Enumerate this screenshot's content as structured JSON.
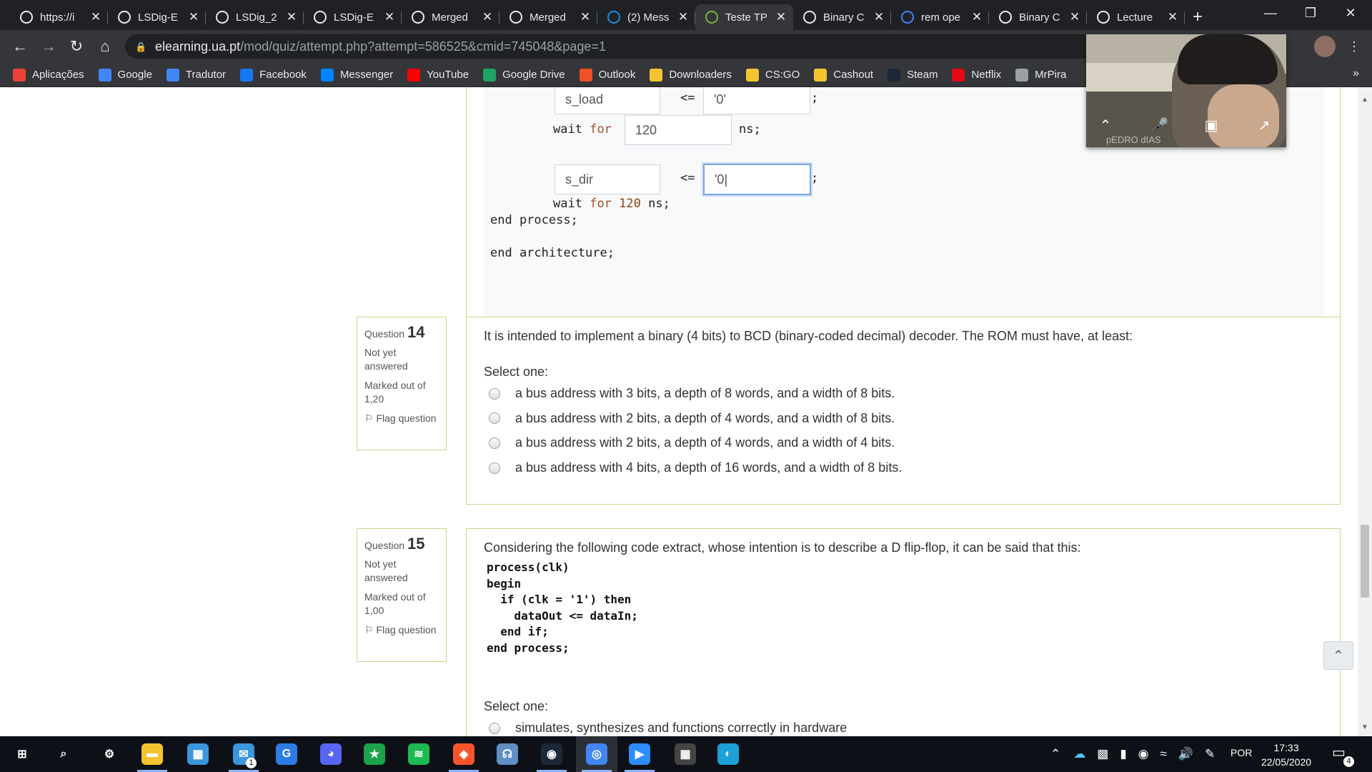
{
  "browser": {
    "tabs": [
      {
        "title": "https://i",
        "icon": "globe-icon",
        "color": "#e8eaed"
      },
      {
        "title": "LSDig-E",
        "icon": "globe-icon",
        "color": "#e8eaed"
      },
      {
        "title": "LSDig_2",
        "icon": "globe-icon",
        "color": "#e8eaed"
      },
      {
        "title": "LSDig-E",
        "icon": "globe-icon",
        "color": "#e8eaed"
      },
      {
        "title": "Merged",
        "icon": "globe-icon",
        "color": "#e8eaed"
      },
      {
        "title": "Merged",
        "icon": "globe-icon",
        "color": "#e8eaed"
      },
      {
        "title": "(2) Mess",
        "icon": "messenger-icon",
        "color": "#1e88e5"
      },
      {
        "title": "Teste TP",
        "icon": "moodle-icon",
        "color": "#7cb342"
      },
      {
        "title": "Binary C",
        "icon": "sheet-icon",
        "color": "#e8eaed"
      },
      {
        "title": "rem ope",
        "icon": "google-icon",
        "color": "#4285f4"
      },
      {
        "title": "Binary C",
        "icon": "sheet-icon",
        "color": "#e8eaed"
      },
      {
        "title": "Lecture",
        "icon": "globe-icon",
        "color": "#e8eaed"
      }
    ],
    "close_glyph": "✕",
    "newtab_glyph": "+",
    "url_host": "elearning.ua.pt",
    "url_path": "/mod/quiz/attempt.php?attempt=586525&cmid=745048&page=1",
    "bookmarks": [
      {
        "label": "Aplicações",
        "icon": "apps-grid-icon",
        "color": "#ea4335"
      },
      {
        "label": "Google",
        "icon": "google-icon",
        "color": "#4285f4"
      },
      {
        "label": "Tradutor",
        "icon": "translate-icon",
        "color": "#4285f4"
      },
      {
        "label": "Facebook",
        "icon": "facebook-icon",
        "color": "#1877f2"
      },
      {
        "label": "Messenger",
        "icon": "messenger-icon",
        "color": "#0084ff"
      },
      {
        "label": "YouTube",
        "icon": "youtube-icon",
        "color": "#ff0000"
      },
      {
        "label": "Google Drive",
        "icon": "drive-icon",
        "color": "#1fa463"
      },
      {
        "label": "Outlook",
        "icon": "windows-icon",
        "color": "#f25022"
      },
      {
        "label": "Downloaders",
        "icon": "folder-icon",
        "color": "#f4c430"
      },
      {
        "label": "CS:GO",
        "icon": "folder-icon",
        "color": "#f4c430"
      },
      {
        "label": "Cashout",
        "icon": "folder-icon",
        "color": "#f4c430"
      },
      {
        "label": "Steam",
        "icon": "steam-icon",
        "color": "#1b2838"
      },
      {
        "label": "Netflix",
        "icon": "netflix-icon",
        "color": "#e50914"
      },
      {
        "label": "MrPira",
        "icon": "pirate-icon",
        "color": "#9aa0a6"
      }
    ],
    "more_glyph": "»"
  },
  "quiz_prev": {
    "line1_field_name": "s_load",
    "line1_op": "<=",
    "line1_field_value": "'0'",
    "semicolon": ";",
    "wait_kw": "wait",
    "for_kw": "for",
    "wait_value": "120",
    "ns_semicolon": "ns;",
    "line2_field_name": "s_dir",
    "line2_op": "<=",
    "line2_field_value": "'0|",
    "wait2_num": "120",
    "end_process": "end process;",
    "end_architecture": "end architecture;"
  },
  "q14": {
    "label": "Question",
    "number": "14",
    "state": "Not yet answered",
    "marked": "Marked out of 1,20",
    "flag_glyph": "⚐",
    "flag": "Flag question",
    "text": "It is intended to implement a binary (4 bits) to BCD (binary-coded decimal) decoder. The ROM must have, at least:",
    "select_one": "Select one:",
    "options": [
      "a bus address with 3 bits, a depth of 8 words, and a width of 8 bits.",
      "a bus address with 2 bits, a depth of 4 words, and a width of 8 bits.",
      "a bus address with 2 bits, a depth of 4 words, and a width of 4 bits.",
      "a bus address with 4 bits, a depth of 16 words, and a width of 8 bits."
    ]
  },
  "q15": {
    "label": "Question",
    "number": "15",
    "state": "Not yet answered",
    "marked": "Marked out of 1,00",
    "flag_glyph": "⚐",
    "flag": "Flag question",
    "text": "Considering the following code extract, whose intention is to describe a D flip-flop, it can be said that this:",
    "code": [
      "process(clk)",
      "begin",
      "  if (clk = '1') then",
      "    dataOut <= dataIn;",
      "  end if;",
      "end process;"
    ],
    "select_one": "Select one:",
    "options": [
      "simulates, synthesizes and functions correctly in hardware"
    ]
  },
  "video_call": {
    "participant_name": "pEDRO dIAS"
  },
  "taskbar": {
    "apps": [
      {
        "name": "start",
        "glyph": "⊞",
        "color": "#ffffff"
      },
      {
        "name": "search",
        "glyph": "⌕",
        "color": "#ffffff"
      },
      {
        "name": "settings",
        "glyph": "⚙",
        "color": "#ffffff"
      },
      {
        "name": "file-explorer",
        "glyph": "▬",
        "color": "#f4c430"
      },
      {
        "name": "media",
        "glyph": "▦",
        "color": "#3a96dd"
      },
      {
        "name": "mail",
        "glyph": "✉",
        "color": "#3a96dd"
      },
      {
        "name": "app-g",
        "glyph": "G",
        "color": "#2d7be5"
      },
      {
        "name": "discord",
        "glyph": "◕",
        "color": "#5865f2"
      },
      {
        "name": "game",
        "glyph": "★",
        "color": "#1aa34a"
      },
      {
        "name": "spotify",
        "glyph": "≋",
        "color": "#1db954"
      },
      {
        "name": "brave",
        "glyph": "◆",
        "color": "#fb542b"
      },
      {
        "name": "headset",
        "glyph": "☊",
        "color": "#5f8fc4"
      },
      {
        "name": "steam",
        "glyph": "◉",
        "color": "#1b2838"
      },
      {
        "name": "chrome",
        "glyph": "◎",
        "color": "#4285f4"
      },
      {
        "name": "zoom",
        "glyph": "▶",
        "color": "#2d8cff"
      },
      {
        "name": "calculator",
        "glyph": "▦",
        "color": "#444444"
      },
      {
        "name": "cisco",
        "glyph": "◐",
        "color": "#1ba0d7"
      }
    ],
    "mail_badge": "1",
    "lang": "POR",
    "time": "17:33",
    "date": "22/05/2020",
    "notif_badge": "4"
  }
}
